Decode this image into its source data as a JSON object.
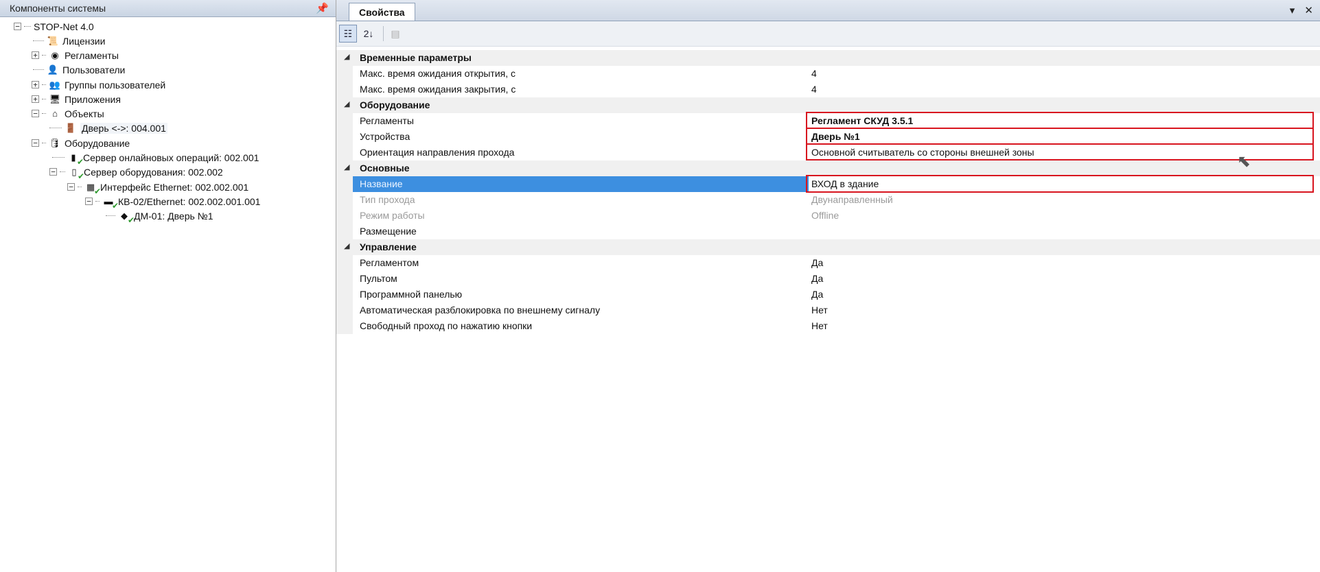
{
  "left": {
    "title": "Компоненты системы",
    "pin": "📌",
    "tree": [
      {
        "label": "STOP-Net 4.0",
        "toggle": "−"
      },
      {
        "label": "Лицензии"
      },
      {
        "label": "Регламенты",
        "toggle": "+"
      },
      {
        "label": "Пользователи"
      },
      {
        "label": "Группы пользователей",
        "toggle": "+"
      },
      {
        "label": "Приложения",
        "toggle": "+"
      },
      {
        "label": "Объекты",
        "toggle": "−"
      },
      {
        "label": "Дверь <->: 004.001"
      },
      {
        "label": "Оборудование",
        "toggle": "−"
      },
      {
        "label": "Сервер онлайновых операций: 002.001"
      },
      {
        "label": "Сервер оборудования: 002.002",
        "toggle": "−"
      },
      {
        "label": "Интерфейс Ethernet: 002.002.001",
        "toggle": "−"
      },
      {
        "label": "КВ-02/Ethernet: 002.002.001.001",
        "toggle": "−"
      },
      {
        "label": "ДМ-01: Дверь №1"
      }
    ]
  },
  "right": {
    "tab_label": "Свойства",
    "ctrl_dropdown": "▾",
    "ctrl_close": "✕",
    "toolbar": {
      "categorized": "☷",
      "alpha": "2↓",
      "pages": "▤"
    },
    "categories": [
      {
        "label": "Временные параметры",
        "tri": "◢"
      },
      {
        "label": "Оборудование",
        "tri": "◢"
      },
      {
        "label": "Основные",
        "tri": "◢"
      },
      {
        "label": "Управление",
        "tri": "◢"
      }
    ],
    "props": [
      {
        "name": "Макс. время ожидания открытия, с",
        "value": "4"
      },
      {
        "name": "Макс. время ожидания закрытия, с",
        "value": "4"
      },
      {
        "name": "Регламенты",
        "value": "Регламент СКУД 3.5.1"
      },
      {
        "name": "Устройства",
        "value": "Дверь №1"
      },
      {
        "name": "Ориентация направления прохода",
        "value": "Основной считыватель со стороны внешней зоны"
      },
      {
        "name": "Название",
        "value": "ВХОД в здание"
      },
      {
        "name": "Тип прохода",
        "value": "Двунаправленный"
      },
      {
        "name": "Режим работы",
        "value": "Offline"
      },
      {
        "name": "Размещение",
        "value": ""
      },
      {
        "name": "Регламентом",
        "value": "Да"
      },
      {
        "name": "Пультом",
        "value": "Да"
      },
      {
        "name": "Программной панелью",
        "value": "Да"
      },
      {
        "name": "Автоматическая разблокировка по внешнему сигналу",
        "value": "Нет"
      },
      {
        "name": "Свободный проход по нажатию кнопки",
        "value": "Нет"
      }
    ]
  }
}
